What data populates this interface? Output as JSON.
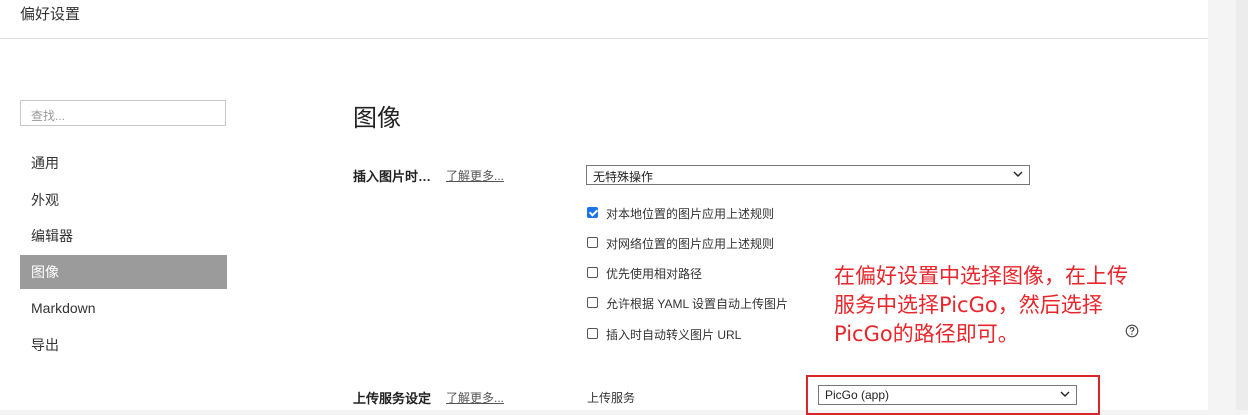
{
  "window": {
    "title": "偏好设置"
  },
  "sidebar": {
    "search_placeholder": "查找...",
    "items": [
      {
        "label": "通用",
        "active": false
      },
      {
        "label": "外观",
        "active": false
      },
      {
        "label": "编辑器",
        "active": false
      },
      {
        "label": "图像",
        "active": true
      },
      {
        "label": "Markdown",
        "active": false
      },
      {
        "label": "导出",
        "active": false
      }
    ]
  },
  "main": {
    "title": "图像",
    "insert_image": {
      "label": "插入图片时…",
      "learn_more": "了解更多...",
      "selected": "无特殊操作"
    },
    "options": [
      {
        "label": "对本地位置的图片应用上述规则",
        "checked": true
      },
      {
        "label": "对网络位置的图片应用上述规则",
        "checked": false
      },
      {
        "label": "优先使用相对路径",
        "checked": false
      },
      {
        "label": "允许根据 YAML 设置自动上传图片",
        "checked": false
      },
      {
        "label": "插入时自动转义图片 URL",
        "checked": false
      }
    ],
    "upload": {
      "label": "上传服务设定",
      "learn_more": "了解更多...",
      "service_label": "上传服务",
      "selected": "PicGo (app)"
    }
  },
  "annotation": {
    "lines": [
      "在偏好设置中选择图像，在上传",
      "服务中选择PicGo，然后选择",
      "PicGo的路径即可。"
    ],
    "color": "#e8262b"
  },
  "colors": {
    "active_nav": "#9b9b9b",
    "checkbox_on": "#1a73e8",
    "highlight_box": "#d9262b"
  }
}
